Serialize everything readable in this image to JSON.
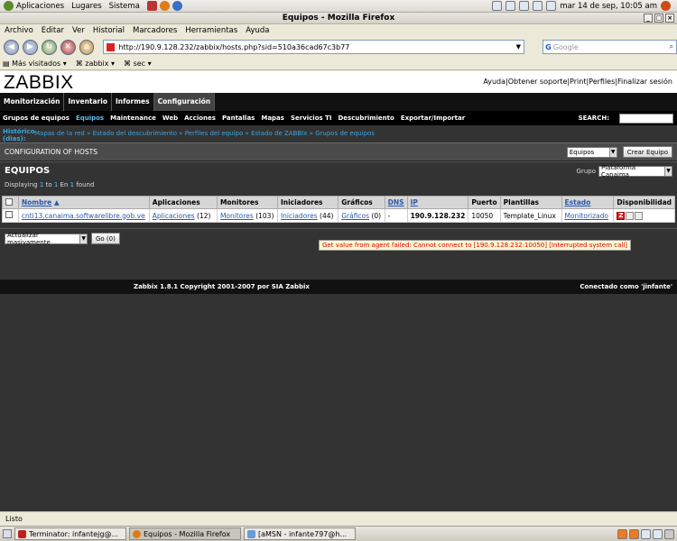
{
  "gnome_top": {
    "menus": [
      "Aplicaciones",
      "Lugares",
      "Sistema"
    ],
    "clock": "mar 14 de sep, 10:05 am"
  },
  "firefox": {
    "title": "Equipos - Mozilla Firefox",
    "menu": [
      "Archivo",
      "Editar",
      "Ver",
      "Historial",
      "Marcadores",
      "Herramientas",
      "Ayuda"
    ],
    "url": "http://190.9.128.232/zabbix/hosts.php?sid=510a36cad67c3b77",
    "search_placeholder": "Google",
    "search_logo": "G",
    "bookmarks": [
      "Más visitados",
      "zabbix",
      "sec"
    ],
    "status": "Listo"
  },
  "zabbix": {
    "logo": "ZABBIX",
    "top_links": "Ayuda|Obtener soporte|Print|Perfiles|Finalizar sesión",
    "main_menu": [
      "Monitorización",
      "Inventario",
      "Informes",
      "Configuración"
    ],
    "sub_menu": [
      "Grupos de equipos",
      "Equipos",
      "Maintenance",
      "Web",
      "Acciones",
      "Pantallas",
      "Mapas",
      "Servicios TI",
      "Descubrimiento",
      "Exportar/Importar"
    ],
    "search_label": "SEARCH:",
    "history_label": "Histórico (dias):",
    "history_crumbs": "Mapas de la red » Estado del descubrimiento » Perfiles del equipo » Estado de ZABBIx » Grupos de equipos",
    "conf_title": "CONFIGURATION OF HOSTS",
    "conf_select": "Equipos",
    "create_button": "Crear Equipo",
    "hosts_title": "EQUIPOS",
    "displaying": {
      "prefix": "Displaying",
      "from": "1",
      "to_word": "to",
      "to": "1",
      "of_word": "En",
      "total": "1",
      "suffix": "found"
    },
    "group_label": "Grupo",
    "group_value": "Plataforma Canaima",
    "columns": [
      "Nombre",
      "Aplicaciones",
      "Monitores",
      "Iniciadores",
      "Gráficos",
      "DNS",
      "IP",
      "Puerto",
      "Plantillas",
      "Estado",
      "Disponibilidad"
    ],
    "row": {
      "name": "cnti13.canaima.softwarelibre.gob.ve",
      "apps": "Aplicaciones",
      "apps_count": "(12)",
      "monitors": "Monitores",
      "monitors_count": "(103)",
      "triggers": "Iniciadores",
      "triggers_count": "(44)",
      "graphs": "Gráficos",
      "graphs_count": "(0)",
      "dns": "-",
      "ip": "190.9.128.232",
      "port": "10050",
      "templates": "Template_Linux",
      "status": "Monitorizado",
      "avail_color": "#e02020"
    },
    "tooltip": "Get value from agent failed: Cannot connect to [190.9.128.232:10050] [Interrupted system call]",
    "mass_select": "Actualizar masivamente",
    "go_button": "Go (0)",
    "footer_copy": "Zabbix 1.8.1 Copyright 2001-2007 por SIA Zabbix",
    "footer_conn": "Conectado como 'jinfante'"
  },
  "taskbar": {
    "tasks": [
      "Terminator: infantejg@...",
      "Equipos - Mozilla Firefox",
      "[aMSN - infante797@h..."
    ]
  }
}
